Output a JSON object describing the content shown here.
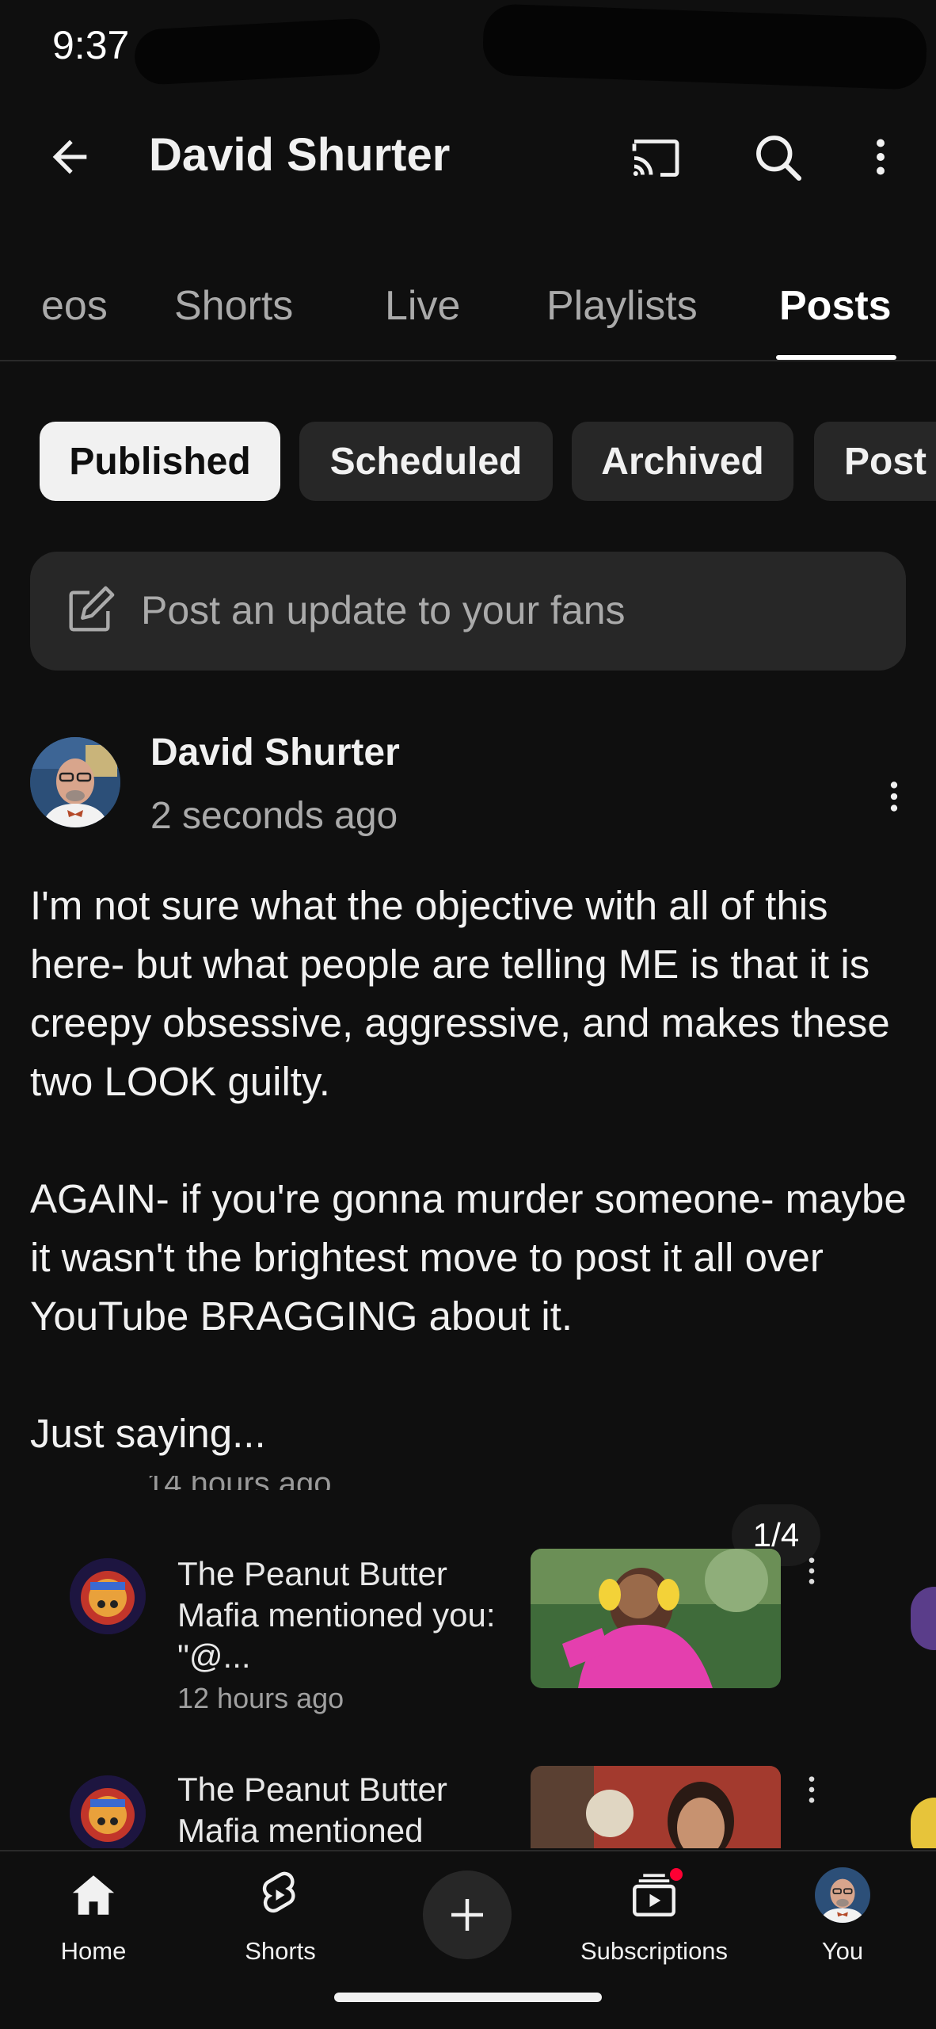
{
  "status_bar": {
    "time": "9:37"
  },
  "header": {
    "title": "David Shurter",
    "icons": [
      "back-arrow-icon",
      "cast-icon",
      "search-icon",
      "more-vert-icon"
    ]
  },
  "tabs": [
    {
      "label": "eos"
    },
    {
      "label": "Shorts"
    },
    {
      "label": "Live"
    },
    {
      "label": "Playlists"
    },
    {
      "label": "Posts",
      "active": true
    }
  ],
  "chips": [
    {
      "label": "Published",
      "active": true
    },
    {
      "label": "Scheduled"
    },
    {
      "label": "Archived"
    },
    {
      "label": "Post"
    }
  ],
  "composer": {
    "placeholder": "Post an update to your fans",
    "icon": "edit-icon"
  },
  "post": {
    "author": "David Shurter",
    "time": "2 seconds ago",
    "body": "I'm not sure what the objective with all of this here- but what people are telling ME is that it is creepy obsessive, aggressive, and makes these two LOOK guilty.\n\nAGAIN- if you're gonna murder someone- maybe it wasn't the brightest move to post it all over YouTube BRAGGING about it.\n\nJust saying...",
    "image_counter": "1/4"
  },
  "embedded_notifications": [
    {
      "text": "The Peanut Butter Mafia mentioned you: \"@...",
      "time": "12 hours ago"
    },
    {
      "text": "The Peanut Butter Mafia mentioned"
    }
  ],
  "bottom_nav": [
    {
      "label": "Home",
      "icon": "home-icon"
    },
    {
      "label": "Shorts",
      "icon": "shorts-icon"
    },
    {
      "label": "",
      "icon": "create-plus-icon"
    },
    {
      "label": "Subscriptions",
      "icon": "subscriptions-icon"
    },
    {
      "label": "You",
      "icon": "avatar"
    }
  ],
  "colors": {
    "background": "#0f0f0f",
    "surface": "#272727",
    "text_primary": "#f1f1f1",
    "text_secondary": "#aaaaaa",
    "notification_dot": "#ff0033"
  }
}
